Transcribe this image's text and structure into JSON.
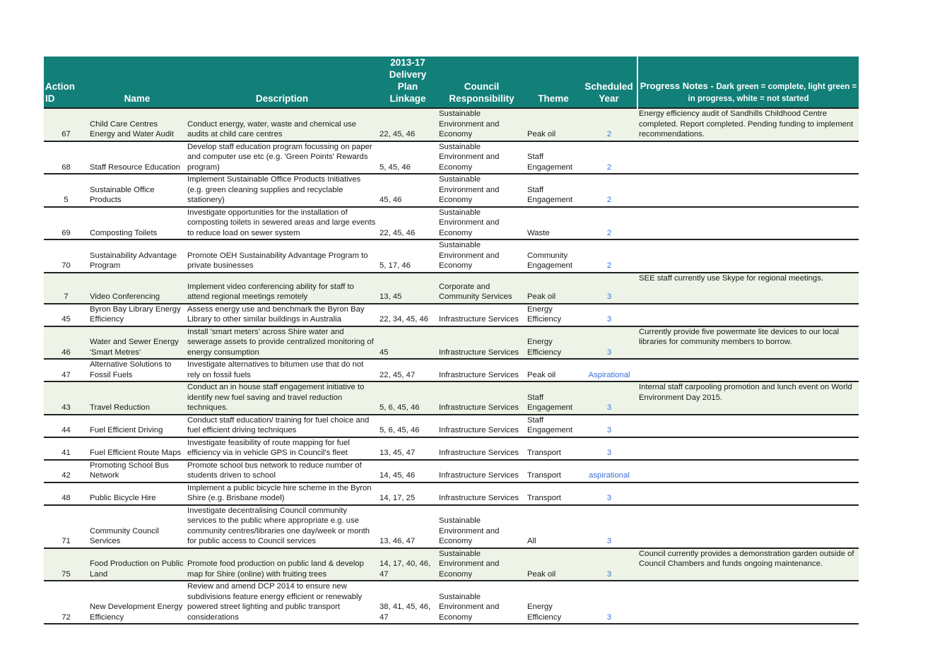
{
  "headers": {
    "id": "Action ID",
    "name": "Name",
    "description": "Description",
    "plan": "2013-17 Delivery Plan Linkage",
    "responsibility": "Council Responsibility",
    "theme": "Theme",
    "year": "Scheduled Year",
    "notes_title": "Progress Notes - ",
    "notes_legend": "Dark green = complete, light green = in progress, white = not started"
  },
  "colors": {
    "header_bg": "#127f78",
    "in_progress_row": "#edf3e6",
    "year_text": "#3b6fd4"
  },
  "rows": [
    {
      "id": "67",
      "name": "Child Care Centres Energy and Water Audit",
      "description": "Conduct energy, water, waste and chemical use audits at child care centres",
      "plan": "22, 45, 46",
      "responsibility": "Sustainable Environment and Economy",
      "theme": "Peak oil",
      "year": "2",
      "notes": "Energy efficiency audit of Sandhills Childhood Centre completed. Report completed. Pending funding to implement recommendations.",
      "status": "in progress"
    },
    {
      "id": "68",
      "name": "Staff Resource Education",
      "description": "Develop staff education program focussing on paper and computer use etc (e.g. 'Green Points' Rewards program)",
      "plan": "5, 45, 46",
      "responsibility": "Sustainable Environment and Economy",
      "theme": "Staff Engagement",
      "year": "2",
      "notes": "",
      "status": "not started"
    },
    {
      "id": "5",
      "name": "Sustainable Office Products",
      "description": "Implement Sustainable Office Products Initiatives (e.g. green cleaning supplies and recyclable stationery)",
      "plan": "45, 46",
      "responsibility": "Sustainable Environment and Economy",
      "theme": "Staff Engagement",
      "year": "2",
      "notes": "",
      "status": "not started"
    },
    {
      "id": "69",
      "name": "Composting Toilets",
      "description": "Investigate opportunities for the installation of composting toilets in sewered areas and large events to reduce load on sewer system",
      "plan": "22, 45, 46",
      "responsibility": "Sustainable Environment and Economy",
      "theme": "Waste",
      "year": "2",
      "notes": "",
      "status": "not started"
    },
    {
      "id": "70",
      "name": "Sustainability Advantage Program",
      "description": "Promote OEH Sustainability Advantage Program to private businesses",
      "plan": "5, 17, 46",
      "responsibility": "Sustainable Environment and Economy",
      "theme": "Community Engagement",
      "year": "2",
      "notes": "",
      "status": "not started"
    },
    {
      "id": "7",
      "name": "Video Conferencing",
      "description": "Implement video conferencing ability for staff to attend regional meetings remotely",
      "plan": "13, 45",
      "responsibility": "Corporate and Community Services",
      "theme": "Peak oil",
      "year": "3",
      "notes": "SEE staff currently use Skype for regional meetings.",
      "status": "in progress"
    },
    {
      "id": "45",
      "name": "Byron Bay Library Energy Efficiency",
      "description": "Assess energy use and benchmark the Byron Bay Library to other similar buildings in Australia",
      "plan": "22, 34, 45, 46",
      "responsibility": "Infrastructure Services",
      "theme": "Energy Efficiency",
      "year": "3",
      "notes": "",
      "status": "not started"
    },
    {
      "id": "46",
      "name": "Water and Sewer Energy 'Smart Metres'",
      "description": "Install 'smart meters' across Shire water and sewerage assets to provide centralized monitoring of energy consumption",
      "plan": "45",
      "responsibility": "Infrastructure Services",
      "theme": "Energy Efficiency",
      "year": "3",
      "notes": "Currently provide five powermate lite devices to our local libraries for community members to borrow.",
      "status": "in progress"
    },
    {
      "id": "47",
      "name": "Alternative Solutions to Fossil Fuels",
      "description": "Investigate alternatives to bitumen use that do not rely on fossil fuels",
      "plan": "22, 45, 47",
      "responsibility": "Infrastructure Services",
      "theme": "Peak oil",
      "year": "Aspirational",
      "notes": "",
      "status": "not started"
    },
    {
      "id": "43",
      "name": "Travel Reduction",
      "description": "Conduct an in house staff engagement initiative to identify new fuel saving and travel reduction techniques.",
      "plan": "5, 6, 45, 46",
      "responsibility": "Infrastructure Services",
      "theme": "Staff Engagement",
      "year": "3",
      "notes": "Internal staff carpooling promotion and lunch event on World Environment Day 2015.",
      "status": "in progress"
    },
    {
      "id": "44",
      "name": "Fuel Efficient Driving",
      "description": "Conduct staff education/ training for fuel choice and fuel efficient driving techniques",
      "plan": "5, 6, 45, 46",
      "responsibility": "Infrastructure Services",
      "theme": "Staff Engagement",
      "year": "3",
      "notes": "",
      "status": "not started"
    },
    {
      "id": "41",
      "name": "Fuel Efficient Route Maps",
      "description": "Investigate feasibility of route mapping for fuel efficiency via in vehicle GPS in Council's fleet",
      "plan": "13, 45, 47",
      "responsibility": "Infrastructure Services",
      "theme": "Transport",
      "year": "3",
      "notes": "",
      "status": "not started"
    },
    {
      "id": "42",
      "name": "Promoting School Bus Network",
      "description": "Promote school bus network to reduce number of students driven to school",
      "plan": "14, 45, 46",
      "responsibility": "Infrastructure Services",
      "theme": "Transport",
      "year": "aspirational",
      "notes": "",
      "status": "not started"
    },
    {
      "id": "48",
      "name": "Public Bicycle Hire",
      "description": "Implement a public bicycle hire scheme in the Byron Shire (e.g. Brisbane model)",
      "plan": "14, 17, 25",
      "responsibility": "Infrastructure Services",
      "theme": "Transport",
      "year": "3",
      "notes": "",
      "status": "not started"
    },
    {
      "id": "71",
      "name": "Community Council Services",
      "description": "Investigate decentralising Council community services to the public where appropriate e.g. use community centres/libraries one day/week or month for public access to Council services",
      "plan": "13, 46, 47",
      "responsibility": "Sustainable Environment and Economy",
      "theme": "All",
      "year": "3",
      "notes": "",
      "status": "not started"
    },
    {
      "id": "75",
      "name": "Food Production on Public Land",
      "description": "Promote food production on public land & develop map for Shire (online) with fruiting trees",
      "plan": "14, 17, 40, 46, 47",
      "responsibility": "Sustainable Environment and Economy",
      "theme": "Peak oil",
      "year": "3",
      "notes": "Council currently provides a demonstration garden outside of Council Chambers and funds ongoing maintenance.",
      "status": "in progress"
    },
    {
      "id": "72",
      "name": "New Development Energy Efficiency",
      "description": "Review and amend DCP 2014 to ensure new subdivisions feature energy efficient or renewably powered  street lighting and public transport considerations",
      "plan": "38, 41, 45, 46, 47",
      "responsibility": "Sustainable Environment and Economy",
      "theme": "Energy Efficiency",
      "year": "3",
      "notes": "",
      "status": "not started"
    }
  ]
}
